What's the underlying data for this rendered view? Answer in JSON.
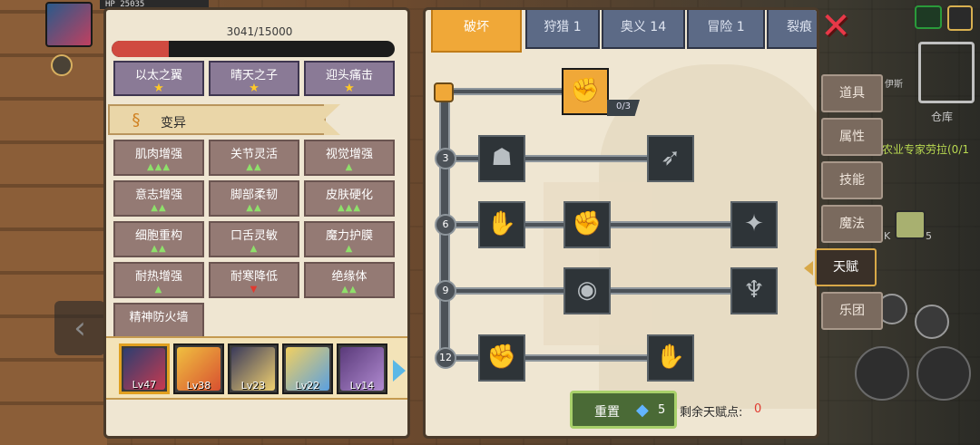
{
  "hud": {
    "hp_text": "HP 25035"
  },
  "xp": {
    "text": "3041/15000",
    "fraction": 0.203
  },
  "traits": [
    {
      "label": "以太之翼",
      "stars": "★"
    },
    {
      "label": "晴天之子",
      "stars": "★"
    },
    {
      "label": "迎头痛击",
      "stars": "★"
    }
  ],
  "category": {
    "label": "变异"
  },
  "mutations": [
    {
      "label": "肌肉增强",
      "marks": "▲▲▲"
    },
    {
      "label": "关节灵活",
      "marks": "▲▲"
    },
    {
      "label": "视觉增强",
      "marks": "▲"
    },
    {
      "label": "意志增强",
      "marks": "▲▲"
    },
    {
      "label": "脚部柔韧",
      "marks": "▲▲"
    },
    {
      "label": "皮肤硬化",
      "marks": "▲▲▲"
    },
    {
      "label": "细胞重构",
      "marks": "▲▲"
    },
    {
      "label": "口舌灵敏",
      "marks": "▲"
    },
    {
      "label": "魔力护膜",
      "marks": "▲"
    },
    {
      "label": "耐热增强",
      "marks": "▲"
    },
    {
      "label": "耐寒降低",
      "marks": "▼"
    },
    {
      "label": "绝缘体",
      "marks": "▲▲"
    },
    {
      "label": "精神防火墙",
      "marks": ""
    }
  ],
  "party": [
    {
      "level": "Lv47",
      "color_a": "#2c3e70",
      "color_b": "#c83a50"
    },
    {
      "level": "Lv38",
      "color_a": "#f0c040",
      "color_b": "#d85030"
    },
    {
      "level": "Lv23",
      "color_a": "#3a3a5a",
      "color_b": "#f0d070"
    },
    {
      "level": "Lv22",
      "color_a": "#f2d060",
      "color_b": "#5aa0e0"
    },
    {
      "level": "Lv14",
      "color_a": "#5a3a7a",
      "color_b": "#b08ad0"
    }
  ],
  "tabs": [
    {
      "label": "破坏"
    },
    {
      "label": "狩猎 1"
    },
    {
      "label": "奥义 14"
    },
    {
      "label": "冒险 1"
    },
    {
      "label": "裂痕"
    }
  ],
  "tree": {
    "tiers": [
      "3",
      "6",
      "9",
      "12"
    ],
    "root_node_count": "0/3",
    "nodes": [
      {
        "icon": "handshake-icon",
        "glyph": "✊"
      },
      {
        "icon": "body-icon",
        "glyph": "☗"
      },
      {
        "icon": "arrow-hit-icon",
        "glyph": "➶"
      },
      {
        "icon": "magic-hand-icon",
        "glyph": "✋"
      },
      {
        "icon": "punch-icon",
        "glyph": "✊"
      },
      {
        "icon": "blade-splash-icon",
        "glyph": "✦"
      },
      {
        "icon": "ripple-icon",
        "glyph": "◉"
      },
      {
        "icon": "bat-wave-icon",
        "glyph": "♆"
      },
      {
        "icon": "raised-fist-icon",
        "glyph": "✊"
      },
      {
        "icon": "gauntlet-icon",
        "glyph": "✋"
      }
    ]
  },
  "reset": {
    "label": "重置",
    "cost": "5"
  },
  "points": {
    "label": "剩余天赋点:",
    "value": "0"
  },
  "side_menu": [
    {
      "label": "道具"
    },
    {
      "label": "属性"
    },
    {
      "label": "技能"
    },
    {
      "label": "魔法"
    },
    {
      "label": "天赋"
    },
    {
      "label": "乐团"
    }
  ],
  "world": {
    "warehouse": "仓库",
    "quest_text": "农业专家劳拉(0/1",
    "npc_text": "伊斯",
    "item_count": "5",
    "item_k": "K"
  }
}
